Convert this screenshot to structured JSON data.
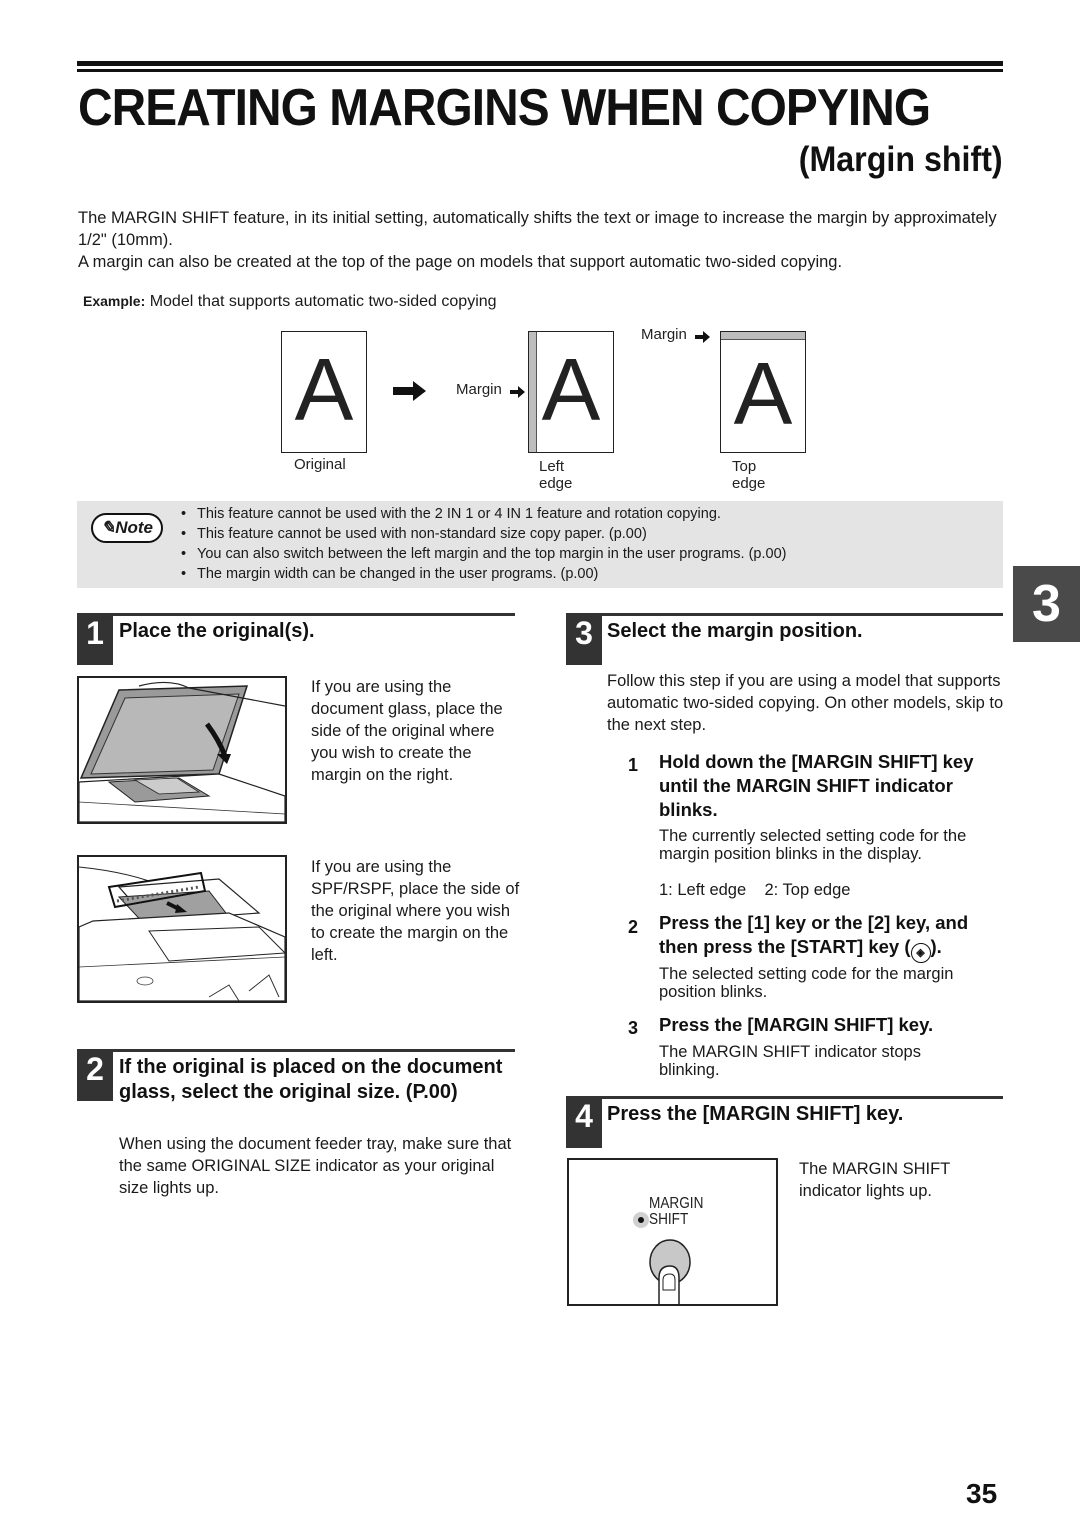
{
  "header": {
    "title": "CREATING MARGINS WHEN COPYING",
    "subtitle": "(Margin shift)"
  },
  "intro": {
    "paragraph1": "The MARGIN SHIFT feature, in its initial setting, automatically shifts the text or image to increase the margin by approximately 1/2\" (10mm).",
    "paragraph2": "A margin can also be created at the top of the page on models that support automatic two-sided copying."
  },
  "example": {
    "label": "Example:",
    "text": " Model that supports automatic two-sided copying"
  },
  "diagram": {
    "letter": "A",
    "original_label": "Original",
    "left_edge_label": "Left edge",
    "top_edge_label": "Top edge",
    "margin_label_left": "Margin",
    "margin_label_top": "Margin",
    "arrow_icon": "right-arrow-icon"
  },
  "note": {
    "badge": "Note",
    "items": [
      "This feature cannot be used with the 2 IN 1 or 4 IN 1 feature and rotation copying.",
      "This feature cannot be used with non-standard size copy paper. (p.00)",
      "You can also switch between the left margin and the top margin in the user programs. (p.00)",
      "The margin width can be changed in the user programs. (p.00)"
    ]
  },
  "chapter_tab": "3",
  "steps": {
    "step1": {
      "number": "1",
      "title": "Place the original(s).",
      "glass_text": "If you are using the document glass, place the side of the original where you wish to create the margin on the right.",
      "spf_text": "If you are using the SPF/RSPF, place the side of the original where you wish to create the margin on the left."
    },
    "step2": {
      "number": "2",
      "title": "If the original is placed on the document glass, select the original size. (P.00)",
      "text": "When using the document feeder tray, make sure that the same ORIGINAL SIZE indicator as your original size lights up."
    },
    "step3": {
      "number": "3",
      "title": "Select the margin position.",
      "text": "Follow this step if you are using a model that supports automatic two-sided copying. On other models, skip to the next step.",
      "substeps": [
        {
          "number": "1",
          "title": "Hold down the [MARGIN SHIFT] key until the MARGIN SHIFT indicator blinks.",
          "text": "The currently selected setting code for the margin position blinks in the display.",
          "codes": "1: Left edge    2: Top edge"
        },
        {
          "number": "2",
          "title_before": "Press the [1] key or the [2] key, and then press the [START] key (",
          "title_after": ").",
          "text": "The selected setting code for the margin position blinks."
        },
        {
          "number": "3",
          "title": "Press the [MARGIN SHIFT] key.",
          "text": "The MARGIN SHIFT indicator stops blinking."
        }
      ]
    },
    "step4": {
      "number": "4",
      "title": "Press the [MARGIN SHIFT] key.",
      "text": "The MARGIN SHIFT indicator lights up.",
      "panel_label_line1": "MARGIN",
      "panel_label_line2": "SHIFT"
    }
  },
  "page_number": "35"
}
